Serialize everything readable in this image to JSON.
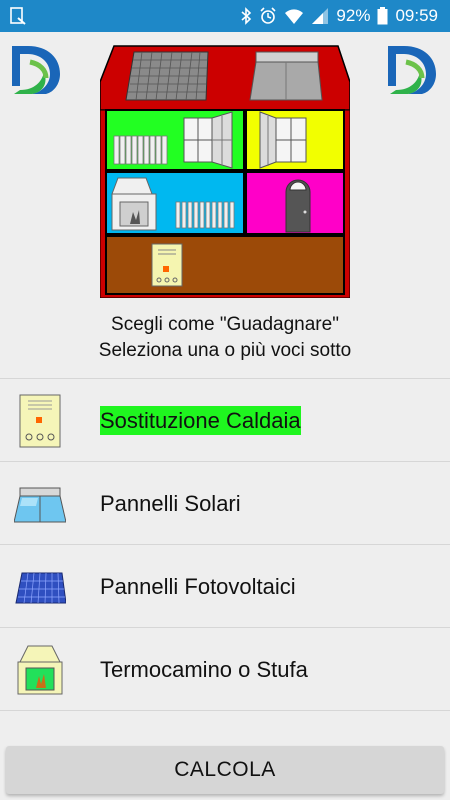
{
  "status_bar": {
    "battery": "92%",
    "time": "09:59",
    "color": "#1e88c8"
  },
  "caption": {
    "line1": "Scegli come \"Guadagnare\"",
    "line2": "Seleziona una o più voci sotto"
  },
  "items": [
    {
      "label": "Sostituzione Caldaia",
      "icon": "boiler-icon",
      "selected": true
    },
    {
      "label": "Pannelli Solari",
      "icon": "solar-thermal-panel-icon",
      "selected": false
    },
    {
      "label": "Pannelli Fotovoltaici",
      "icon": "photovoltaic-panel-icon",
      "selected": false
    },
    {
      "label": "Termocamino o Stufa",
      "icon": "fireplace-icon",
      "selected": false
    }
  ],
  "calculate_button": "CALCOLA",
  "colors": {
    "selected_highlight": "#1ff51f",
    "roof": "#cc0000",
    "room_green": "#22ff22",
    "room_yellow": "#f2ff00",
    "room_blue": "#00b8f0",
    "room_magenta": "#ff00c8",
    "basement": "#9c4a08"
  }
}
